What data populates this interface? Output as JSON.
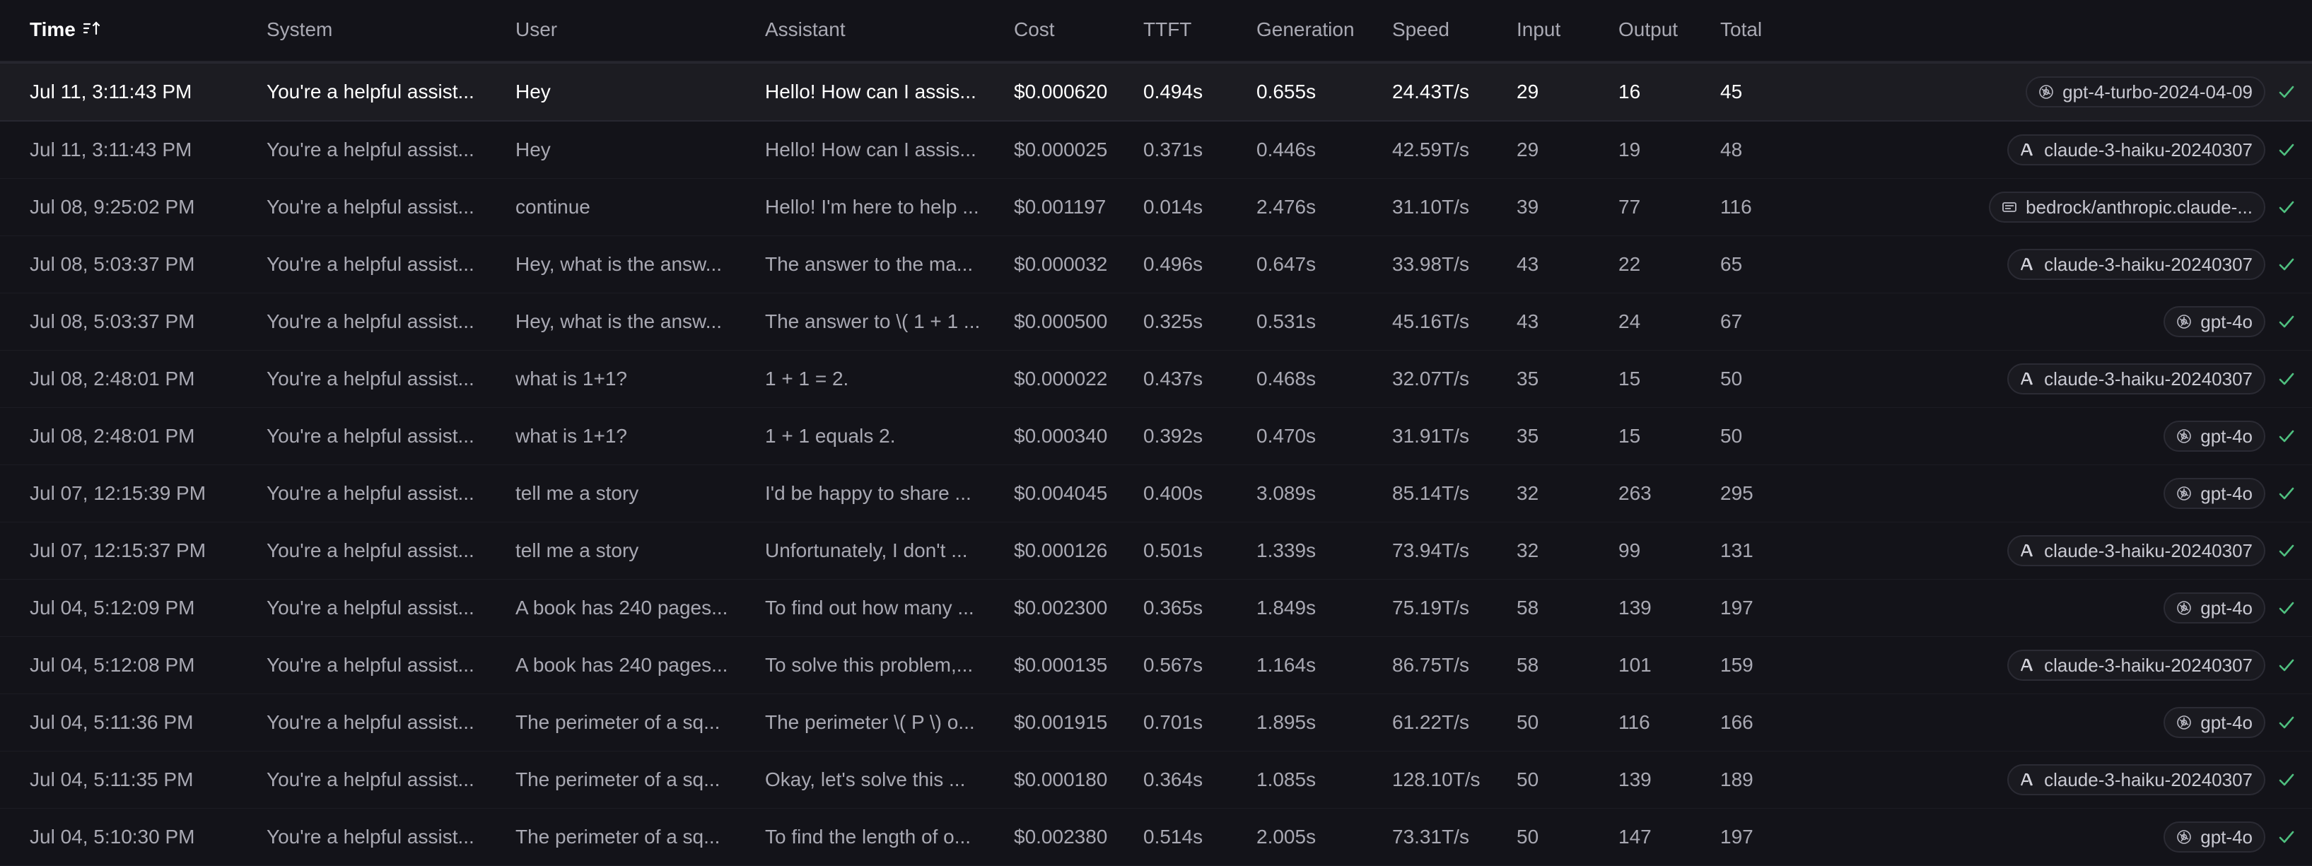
{
  "columns": {
    "time": "Time",
    "system": "System",
    "user": "User",
    "assistant": "Assistant",
    "cost": "Cost",
    "ttft": "TTFT",
    "generation": "Generation",
    "speed": "Speed",
    "input": "Input",
    "output": "Output",
    "total": "Total"
  },
  "colors": {
    "accent_check": "#4fbf7f",
    "selected_row": "#1c1c22"
  },
  "rows": [
    {
      "time": "Jul 11, 3:11:43 PM",
      "system": "You're a helpful assist...",
      "user": "Hey",
      "assistant": "Hello! How can I assis...",
      "cost": "$0.000620",
      "ttft": "0.494s",
      "generation": "0.655s",
      "speed": "24.43T/s",
      "input": "29",
      "output": "16",
      "total": "45",
      "model": "gpt-4-turbo-2024-04-09",
      "model_icon": "openai-icon",
      "selected": true
    },
    {
      "time": "Jul 11, 3:11:43 PM",
      "system": "You're a helpful assist...",
      "user": "Hey",
      "assistant": "Hello! How can I assis...",
      "cost": "$0.000025",
      "ttft": "0.371s",
      "generation": "0.446s",
      "speed": "42.59T/s",
      "input": "29",
      "output": "19",
      "total": "48",
      "model": "claude-3-haiku-20240307",
      "model_icon": "anthropic-icon"
    },
    {
      "time": "Jul 08, 9:25:02 PM",
      "system": "You're a helpful assist...",
      "user": "continue",
      "assistant": "Hello! I'm here to help ...",
      "cost": "$0.001197",
      "ttft": "0.014s",
      "generation": "2.476s",
      "speed": "31.10T/s",
      "input": "39",
      "output": "77",
      "total": "116",
      "model": "bedrock/anthropic.claude-...",
      "model_icon": "bedrock-icon"
    },
    {
      "time": "Jul 08, 5:03:37 PM",
      "system": "You're a helpful assist...",
      "user": "Hey, what is the answ...",
      "assistant": "The answer to the ma...",
      "cost": "$0.000032",
      "ttft": "0.496s",
      "generation": "0.647s",
      "speed": "33.98T/s",
      "input": "43",
      "output": "22",
      "total": "65",
      "model": "claude-3-haiku-20240307",
      "model_icon": "anthropic-icon"
    },
    {
      "time": "Jul 08, 5:03:37 PM",
      "system": "You're a helpful assist...",
      "user": "Hey, what is the answ...",
      "assistant": "The answer to \\( 1 + 1 ...",
      "cost": "$0.000500",
      "ttft": "0.325s",
      "generation": "0.531s",
      "speed": "45.16T/s",
      "input": "43",
      "output": "24",
      "total": "67",
      "model": "gpt-4o",
      "model_icon": "openai-icon"
    },
    {
      "time": "Jul 08, 2:48:01 PM",
      "system": "You're a helpful assist...",
      "user": "what is 1+1?",
      "assistant": "1 + 1 = 2.",
      "cost": "$0.000022",
      "ttft": "0.437s",
      "generation": "0.468s",
      "speed": "32.07T/s",
      "input": "35",
      "output": "15",
      "total": "50",
      "model": "claude-3-haiku-20240307",
      "model_icon": "anthropic-icon"
    },
    {
      "time": "Jul 08, 2:48:01 PM",
      "system": "You're a helpful assist...",
      "user": "what is 1+1?",
      "assistant": "1 + 1 equals 2.",
      "cost": "$0.000340",
      "ttft": "0.392s",
      "generation": "0.470s",
      "speed": "31.91T/s",
      "input": "35",
      "output": "15",
      "total": "50",
      "model": "gpt-4o",
      "model_icon": "openai-icon"
    },
    {
      "time": "Jul 07, 12:15:39 PM",
      "system": "You're a helpful assist...",
      "user": "tell me a story",
      "assistant": "I'd be happy to share ...",
      "cost": "$0.004045",
      "ttft": "0.400s",
      "generation": "3.089s",
      "speed": "85.14T/s",
      "input": "32",
      "output": "263",
      "total": "295",
      "model": "gpt-4o",
      "model_icon": "openai-icon"
    },
    {
      "time": "Jul 07, 12:15:37 PM",
      "system": "You're a helpful assist...",
      "user": "tell me a story",
      "assistant": "Unfortunately, I don't ...",
      "cost": "$0.000126",
      "ttft": "0.501s",
      "generation": "1.339s",
      "speed": "73.94T/s",
      "input": "32",
      "output": "99",
      "total": "131",
      "model": "claude-3-haiku-20240307",
      "model_icon": "anthropic-icon"
    },
    {
      "time": "Jul 04, 5:12:09 PM",
      "system": "You're a helpful assist...",
      "user": "A book has 240 pages...",
      "assistant": "To find out how many ...",
      "cost": "$0.002300",
      "ttft": "0.365s",
      "generation": "1.849s",
      "speed": "75.19T/s",
      "input": "58",
      "output": "139",
      "total": "197",
      "model": "gpt-4o",
      "model_icon": "openai-icon"
    },
    {
      "time": "Jul 04, 5:12:08 PM",
      "system": "You're a helpful assist...",
      "user": "A book has 240 pages...",
      "assistant": "To solve this problem,...",
      "cost": "$0.000135",
      "ttft": "0.567s",
      "generation": "1.164s",
      "speed": "86.75T/s",
      "input": "58",
      "output": "101",
      "total": "159",
      "model": "claude-3-haiku-20240307",
      "model_icon": "anthropic-icon"
    },
    {
      "time": "Jul 04, 5:11:36 PM",
      "system": "You're a helpful assist...",
      "user": "The perimeter of a sq...",
      "assistant": "The perimeter \\( P \\) o...",
      "cost": "$0.001915",
      "ttft": "0.701s",
      "generation": "1.895s",
      "speed": "61.22T/s",
      "input": "50",
      "output": "116",
      "total": "166",
      "model": "gpt-4o",
      "model_icon": "openai-icon"
    },
    {
      "time": "Jul 04, 5:11:35 PM",
      "system": "You're a helpful assist...",
      "user": "The perimeter of a sq...",
      "assistant": "Okay, let's solve this ...",
      "cost": "$0.000180",
      "ttft": "0.364s",
      "generation": "1.085s",
      "speed": "128.10T/s",
      "input": "50",
      "output": "139",
      "total": "189",
      "model": "claude-3-haiku-20240307",
      "model_icon": "anthropic-icon"
    },
    {
      "time": "Jul 04, 5:10:30 PM",
      "system": "You're a helpful assist...",
      "user": "The perimeter of a sq...",
      "assistant": "To find the length of o...",
      "cost": "$0.002380",
      "ttft": "0.514s",
      "generation": "2.005s",
      "speed": "73.31T/s",
      "input": "50",
      "output": "147",
      "total": "197",
      "model": "gpt-4o",
      "model_icon": "openai-icon"
    }
  ]
}
